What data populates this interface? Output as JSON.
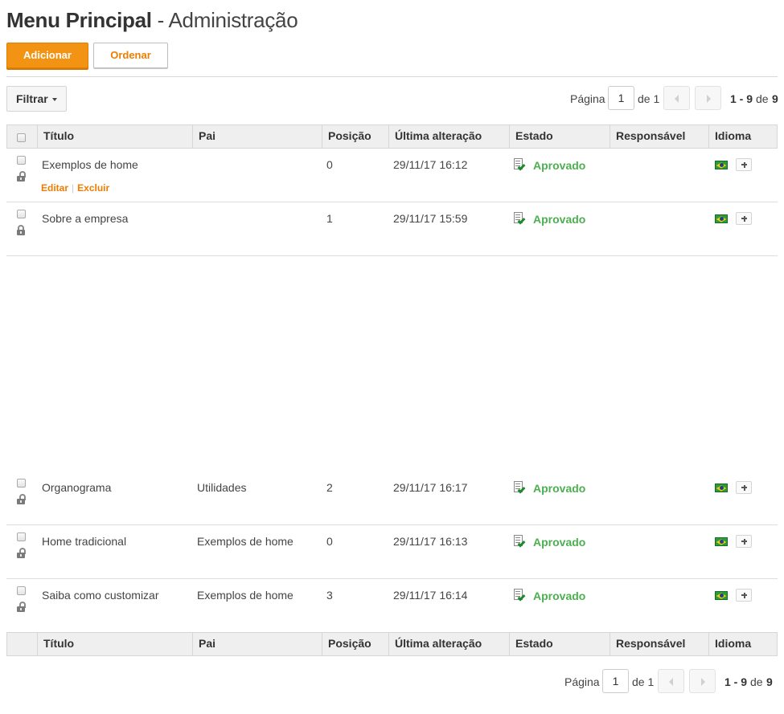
{
  "page": {
    "title_main": "Menu Principal",
    "title_separator": " - ",
    "title_sub": "Administração"
  },
  "toolbar": {
    "add_label": "Adicionar",
    "order_label": "Ordenar",
    "filter_label": "Filtrar"
  },
  "pagination": {
    "page_label": "Página",
    "current_page": "1",
    "of_label": "de",
    "total_pages": "1",
    "range": "1 - 9",
    "de_label": "de",
    "total_items": "9"
  },
  "table": {
    "columns": [
      "Título",
      "Pai",
      "Posição",
      "Última alteração",
      "Estado",
      "Responsável",
      "Idioma"
    ],
    "row_actions": {
      "edit": "Editar",
      "delete": "Excluir"
    },
    "rows": [
      {
        "title": "Exemplos de home",
        "parent": "",
        "position": "0",
        "modified": "29/11/17 16:12",
        "state": "Aprovado",
        "responsible": "",
        "lock": "open"
      },
      {
        "title": "Sobre a empresa",
        "parent": "",
        "position": "1",
        "modified": "29/11/17 15:59",
        "state": "Aprovado",
        "responsible": "",
        "lock": "locked"
      },
      {
        "title": "Organograma",
        "parent": "Utilidades",
        "position": "2",
        "modified": "29/11/17 16:17",
        "state": "Aprovado",
        "responsible": "",
        "lock": "open"
      },
      {
        "title": "Home tradicional",
        "parent": "Exemplos de home",
        "position": "0",
        "modified": "29/11/17 16:13",
        "state": "Aprovado",
        "responsible": "",
        "lock": "open"
      },
      {
        "title": "Saiba como customizar",
        "parent": "Exemplos de home",
        "position": "3",
        "modified": "29/11/17 16:14",
        "state": "Aprovado",
        "responsible": "",
        "lock": "open"
      }
    ]
  },
  "icons": {
    "state": "document-approved-icon",
    "language": "brazil-flag-icon",
    "add_language": "plus-icon",
    "lock": "lock-icon"
  },
  "colors": {
    "accent": "#f39313",
    "accent_text": "#ee7d00",
    "approved": "#4caf50"
  }
}
